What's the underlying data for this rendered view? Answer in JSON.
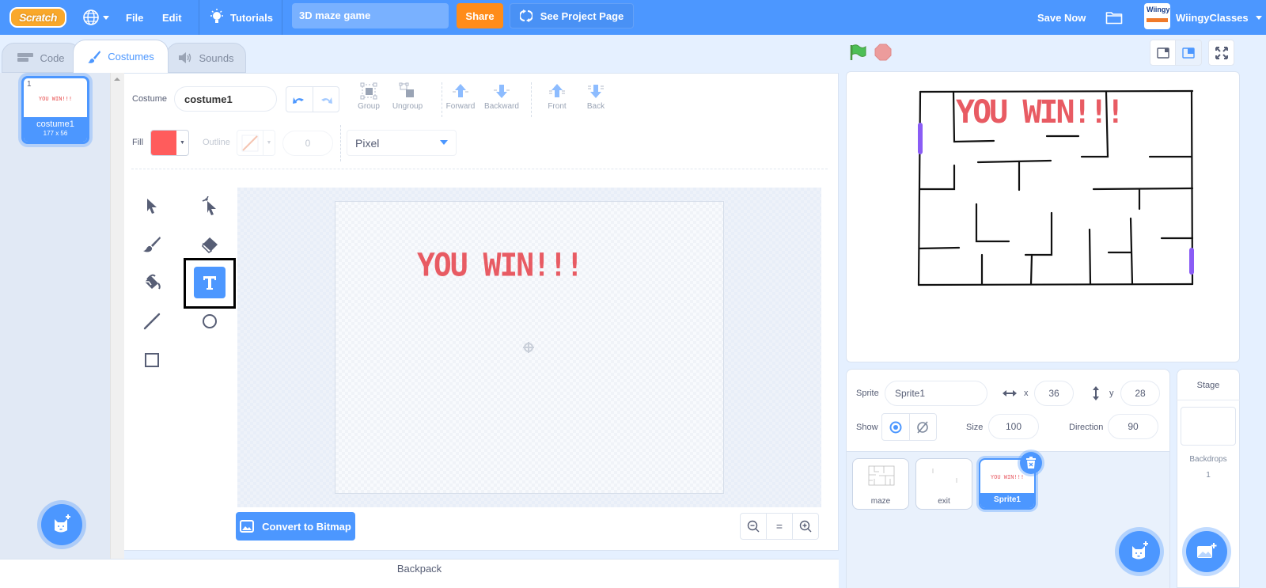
{
  "menubar": {
    "logo": "Scratch",
    "language_icon": "globe-icon",
    "file": "File",
    "edit": "Edit",
    "tutorials": "Tutorials",
    "project_title": "3D maze game",
    "share": "Share",
    "see_project_page": "See Project Page",
    "save_now": "Save Now",
    "username": "WiingyClasses",
    "avatar_text": "Wiingy"
  },
  "tabs": [
    {
      "label": "Code",
      "icon": "code-icon",
      "active": false
    },
    {
      "label": "Costumes",
      "icon": "brush-icon",
      "active": true
    },
    {
      "label": "Sounds",
      "icon": "speaker-icon",
      "active": false
    }
  ],
  "costumes": [
    {
      "index": "1",
      "name": "costume1",
      "size": "177 x 56",
      "preview_text": "YOU WIN!!!",
      "selected": true
    }
  ],
  "paint_editor": {
    "costume_label": "Costume",
    "costume_name": "costume1",
    "tools_top": [
      {
        "label": "Group",
        "icon": "group-icon"
      },
      {
        "label": "Ungroup",
        "icon": "ungroup-icon"
      },
      {
        "label": "Forward",
        "icon": "forward-icon"
      },
      {
        "label": "Backward",
        "icon": "backward-icon"
      },
      {
        "label": "Front",
        "icon": "front-icon"
      },
      {
        "label": "Back",
        "icon": "back-icon"
      }
    ],
    "fill_label": "Fill",
    "fill_color": "#ff5c5c",
    "outline_label": "Outline",
    "outline_width": "0",
    "font": "Pixel",
    "selected_tool": "text",
    "canvas_text": "YOU WIN!!!",
    "convert_button": "Convert to Bitmap",
    "zoom_reset": "="
  },
  "backpack": "Backpack",
  "sprite_info": {
    "sprite_label": "Sprite",
    "sprite_name": "Sprite1",
    "x_label": "x",
    "x": "36",
    "y_label": "y",
    "y": "28",
    "show_label": "Show",
    "visible": true,
    "size_label": "Size",
    "size": "100",
    "direction_label": "Direction",
    "direction": "90"
  },
  "sprites": [
    {
      "name": "maze",
      "selected": false
    },
    {
      "name": "exit",
      "selected": false
    },
    {
      "name": "Sprite1",
      "selected": true,
      "preview_text": "YOU WIN!!!"
    }
  ],
  "stage_panel": {
    "title": "Stage",
    "backdrops_label": "Backdrops",
    "backdrops_count": "1"
  },
  "stage": {
    "text": "YOU WIN!!!"
  },
  "colors": {
    "accent": "#4c97ff",
    "share": "#ff8c1a",
    "text_red": "#e85b63",
    "exit_purple": "#8a5cf5"
  }
}
